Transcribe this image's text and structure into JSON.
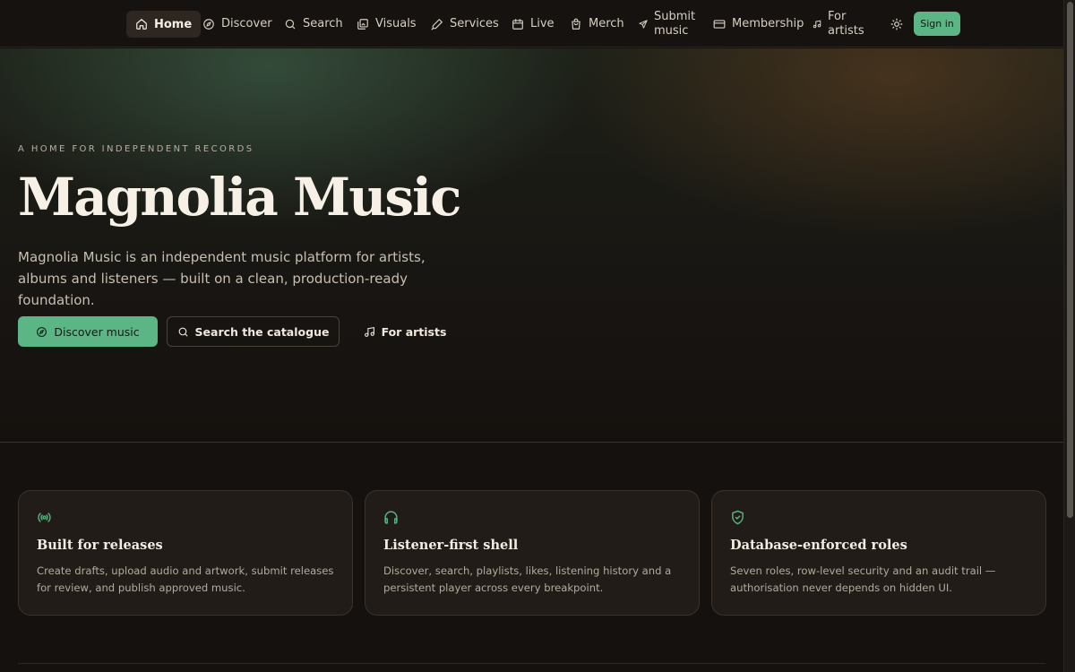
{
  "nav": {
    "items": [
      {
        "label": "Home",
        "icon": "home-icon"
      },
      {
        "label": "Discover",
        "icon": "compass-icon"
      },
      {
        "label": "Search",
        "icon": "search-icon"
      },
      {
        "label": "Visuals",
        "icon": "images-icon"
      },
      {
        "label": "Services",
        "icon": "pen-icon"
      },
      {
        "label": "Live",
        "icon": "calendar-icon"
      },
      {
        "label": "Merch",
        "icon": "bag-icon"
      },
      {
        "label_line1": "Submit",
        "label_line2": "music",
        "icon": "send-icon"
      },
      {
        "label": "Membership",
        "icon": "card-icon"
      },
      {
        "label_line1": "For",
        "label_line2": "artists",
        "icon": "music-note-icon"
      }
    ],
    "theme_icon": "sun-icon",
    "signin_label": "Sign in"
  },
  "hero": {
    "eyebrow": "A HOME FOR INDEPENDENT RECORDS",
    "title": "Magnolia Music",
    "lead": "Magnolia Music is an independent music platform for artists, albums and listeners — built on a clean, production-ready foundation.",
    "primary_label": "Discover music",
    "secondary_label": "Search the catalogue",
    "tertiary_label": "For artists"
  },
  "features": [
    {
      "icon": "broadcast-icon",
      "title": "Built for releases",
      "text": "Create drafts, upload audio and artwork, submit releases for review, and publish approved music."
    },
    {
      "icon": "headphones-icon",
      "title": "Listener-first shell",
      "text": "Discover, search, playlists, likes, listening history and a persistent player across every breakpoint."
    },
    {
      "icon": "shield-check-icon",
      "title": "Database-enforced roles",
      "text": "Seven roles, row-level security and an audit trail — authorisation never depends on hidden UI."
    }
  ],
  "colors": {
    "accent": "#5bb585",
    "background": "#15110e",
    "card": "#221c18"
  }
}
